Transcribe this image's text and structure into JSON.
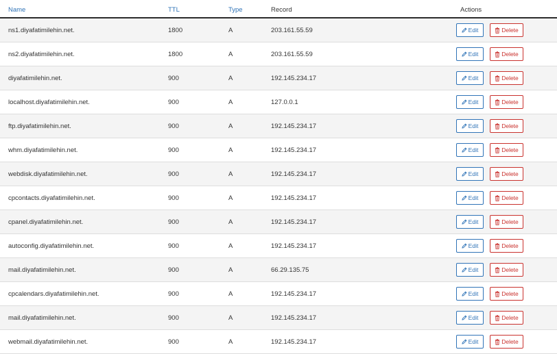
{
  "headers": {
    "name": "Name",
    "ttl": "TTL",
    "type": "Type",
    "record": "Record",
    "actions": "Actions"
  },
  "buttons": {
    "edit_label": "Edit",
    "delete_label": "Delete",
    "edit_icon": "pencil-icon",
    "delete_icon": "trash-icon"
  },
  "colors": {
    "link": "#2f73b7",
    "danger": "#c9302c",
    "row_alt": "#f4f4f4"
  },
  "records": [
    {
      "name": "ns1.diyafatimilehin.net.",
      "ttl": "1800",
      "type": "A",
      "record": "203.161.55.59"
    },
    {
      "name": "ns2.diyafatimilehin.net.",
      "ttl": "1800",
      "type": "A",
      "record": "203.161.55.59"
    },
    {
      "name": "diyafatimilehin.net.",
      "ttl": "900",
      "type": "A",
      "record": "192.145.234.17"
    },
    {
      "name": "localhost.diyafatimilehin.net.",
      "ttl": "900",
      "type": "A",
      "record": "127.0.0.1"
    },
    {
      "name": "ftp.diyafatimilehin.net.",
      "ttl": "900",
      "type": "A",
      "record": "192.145.234.17"
    },
    {
      "name": "whm.diyafatimilehin.net.",
      "ttl": "900",
      "type": "A",
      "record": "192.145.234.17"
    },
    {
      "name": "webdisk.diyafatimilehin.net.",
      "ttl": "900",
      "type": "A",
      "record": "192.145.234.17"
    },
    {
      "name": "cpcontacts.diyafatimilehin.net.",
      "ttl": "900",
      "type": "A",
      "record": "192.145.234.17"
    },
    {
      "name": "cpanel.diyafatimilehin.net.",
      "ttl": "900",
      "type": "A",
      "record": "192.145.234.17"
    },
    {
      "name": "autoconfig.diyafatimilehin.net.",
      "ttl": "900",
      "type": "A",
      "record": "192.145.234.17"
    },
    {
      "name": "mail.diyafatimilehin.net.",
      "ttl": "900",
      "type": "A",
      "record": "66.29.135.75"
    },
    {
      "name": "cpcalendars.diyafatimilehin.net.",
      "ttl": "900",
      "type": "A",
      "record": "192.145.234.17"
    },
    {
      "name": "mail.diyafatimilehin.net.",
      "ttl": "900",
      "type": "A",
      "record": "192.145.234.17"
    },
    {
      "name": "webmail.diyafatimilehin.net.",
      "ttl": "900",
      "type": "A",
      "record": "192.145.234.17"
    }
  ]
}
